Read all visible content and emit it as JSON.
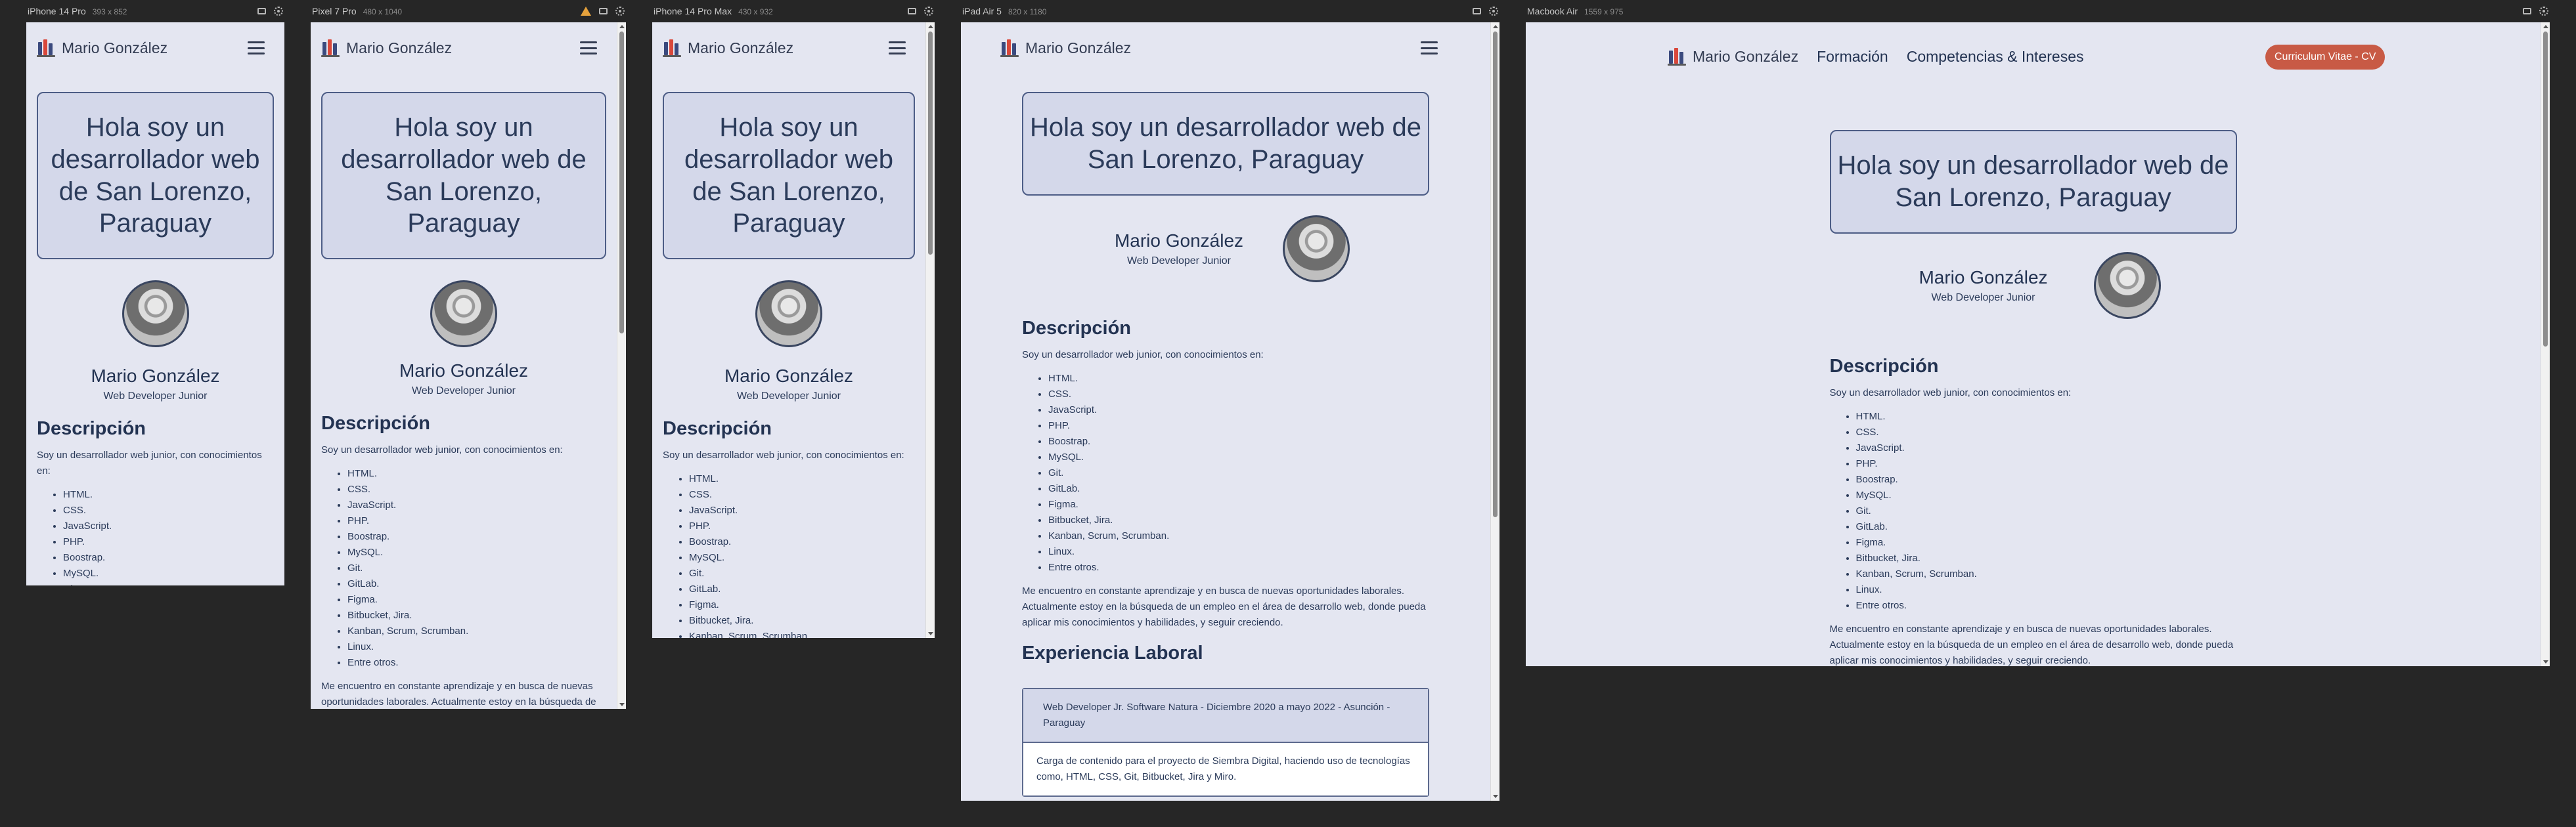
{
  "devices": [
    {
      "label": "iPhone 14 Pro",
      "size": "393 x 852"
    },
    {
      "label": "Pixel 7 Pro",
      "size": "480 x 1040"
    },
    {
      "label": "iPhone 14 Pro Max",
      "size": "430 x 932"
    },
    {
      "label": "iPad Air 5",
      "size": "820 x 1180"
    },
    {
      "label": "Macbook Air",
      "size": "1559 x 975"
    }
  ],
  "site": {
    "brand": "Mario González",
    "nav_formacion": "Formación",
    "nav_competencias": "Competencias & Intereses",
    "cv_button": "Curriculum Vitae - CV",
    "hero": "Hola soy un desarrollador web de San Lorenzo, Paraguay",
    "name": "Mario González",
    "role": "Web Developer Junior",
    "desc_title": "Descripción",
    "desc_intro": "Soy un desarrollador web junior, con conocimientos en:",
    "skills": [
      "HTML.",
      "CSS.",
      "JavaScript.",
      "PHP.",
      "Boostrap.",
      "MySQL.",
      "Git.",
      "GitLab.",
      "Figma.",
      "Bitbucket, Jira.",
      "Kanban, Scrum, Scrumban.",
      "Linux.",
      "Entre otros."
    ],
    "desc_outro": "Me encuentro en constante aprendizaje y en busca de nuevas oportunidades laborales. Actualmente estoy en la búsqueda de un empleo en el área de desarrollo web, donde pueda aplicar mis conocimientos y habilidades, y seguir creciendo.",
    "xp_title": "Experiencia Laboral",
    "xp_head": "Web Developer Jr. Software Natura - Diciembre 2020 a mayo 2022 - Asunción - Paraguay",
    "xp_body": "Carga de contenido para el proyecto de Siembra Digital, haciendo uso de tecnologías como, HTML, CSS, Git, Bitbucket, Jira y Miro."
  },
  "colors": {
    "page_bg": "#e4e6f1",
    "hero_bg": "#d4d8ea",
    "accent": "#c85a45",
    "text": "#2b3b5a",
    "frame_bg": "#262626"
  }
}
